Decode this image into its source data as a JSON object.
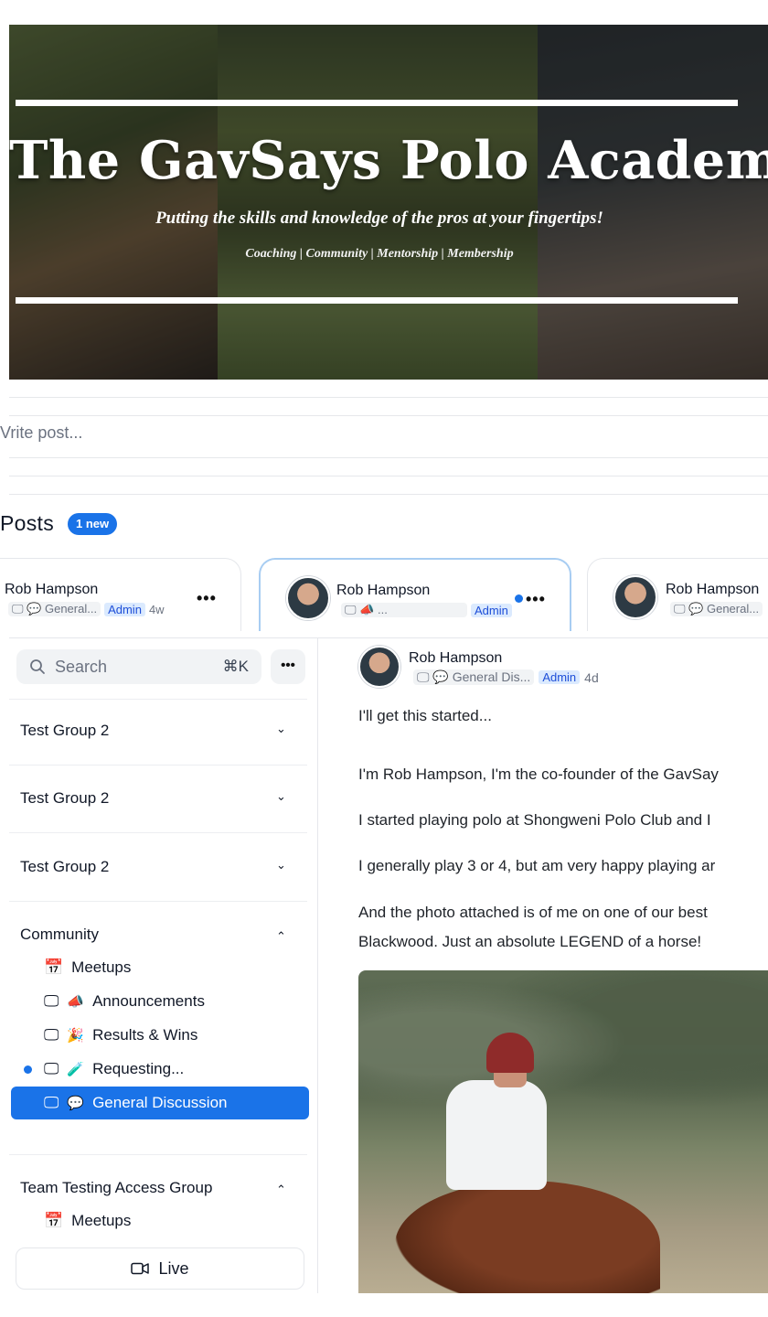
{
  "banner": {
    "title": "The GavSays Polo Academy",
    "tagline": "Putting the skills and knowledge of the pros at your fingertips!",
    "subline": "Coaching | Community | Mentorship | Membership"
  },
  "composer": {
    "placeholder": "Vrite post..."
  },
  "posts_section": {
    "heading": "Posts",
    "badge": "1 new"
  },
  "post_cards": [
    {
      "author": "Rob Hampson",
      "channel": "General...",
      "role": "Admin",
      "age": "4w",
      "more": "•••"
    },
    {
      "author": "Rob Hampson",
      "channel": "...",
      "role": "Admin",
      "age": "",
      "more": "•••",
      "unread": true
    },
    {
      "author": "Rob Hampson",
      "channel": "General...",
      "role": "",
      "age": "",
      "more": ""
    }
  ],
  "sidebar": {
    "search_placeholder": "Search",
    "search_shortcut": "⌘K",
    "more": "•••",
    "groups": [
      {
        "label": "Test Group 2",
        "chevron": "⌄"
      },
      {
        "label": "Test Group 2",
        "chevron": "⌄"
      },
      {
        "label": "Test Group 2",
        "chevron": "⌄"
      },
      {
        "label": "Community",
        "chevron": "⌃"
      },
      {
        "label": "Team Testing Access Group",
        "chevron": "⌃"
      }
    ],
    "community_items": [
      {
        "label": "Meetups",
        "icon": "calendar-icon",
        "emoji": ""
      },
      {
        "label": "Announcements",
        "icon": "monitor-icon",
        "emoji": "📣"
      },
      {
        "label": "Results & Wins",
        "icon": "monitor-icon",
        "emoji": "🎉"
      },
      {
        "label": "Requesting...",
        "icon": "monitor-icon",
        "emoji": "🧪",
        "unread": true
      },
      {
        "label": "General Discussion",
        "icon": "monitor-icon",
        "emoji": "💬",
        "selected": true
      }
    ],
    "team_items": [
      {
        "label": "Meetups",
        "icon": "calendar-icon"
      }
    ],
    "live_button": "Live"
  },
  "post_detail": {
    "author": "Rob Hampson",
    "channel": "General Dis...",
    "role": "Admin",
    "age": "4d",
    "lines": [
      "I'll get this started...",
      "I'm Rob Hampson, I'm the co-founder of the GavSay",
      "I started playing polo at Shongweni Polo Club and I",
      "I generally play 3 or 4, but am very happy playing ar",
      "And the photo attached is of me on one of our best",
      "Blackwood. Just an absolute LEGEND of a horse!"
    ]
  },
  "colors": {
    "accent": "#1a73e8",
    "admin_bg": "#dbeafe",
    "admin_text": "#1d4ed8"
  }
}
